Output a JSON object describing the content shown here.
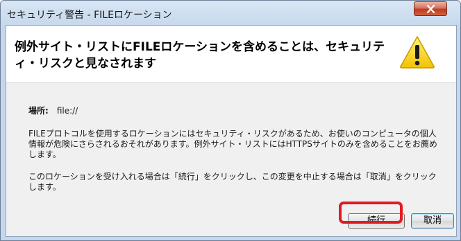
{
  "window": {
    "title": "セキュリティ警告 - FILEロケーション",
    "close_icon": "close-icon"
  },
  "header": {
    "text": "例外サイト・リストにFILEロケーションを含めることは、セキュリティ・リスクと見なされます",
    "icon": "warning-icon"
  },
  "location": {
    "label": "場所:",
    "value": "file://"
  },
  "messages": {
    "paragraph1": "FILEプロトコルを使用するロケーションにはセキュリティ・リスクがあるため、お使いのコンピュータの個人情報が危険にさらされるおそれがあります。例外サイト・リストにはHTTPSサイトのみを含めることをお薦めします。",
    "paragraph2": "このロケーションを受け入れる場合は「続行」をクリックし、この変更を中止する場合は「取消」をクリックします。"
  },
  "buttons": {
    "continue_label": "続行",
    "cancel_label": "取消"
  },
  "colors": {
    "highlight": "#e21b23",
    "close_button": "#c7412a",
    "warning_icon": "#f5d20b"
  }
}
